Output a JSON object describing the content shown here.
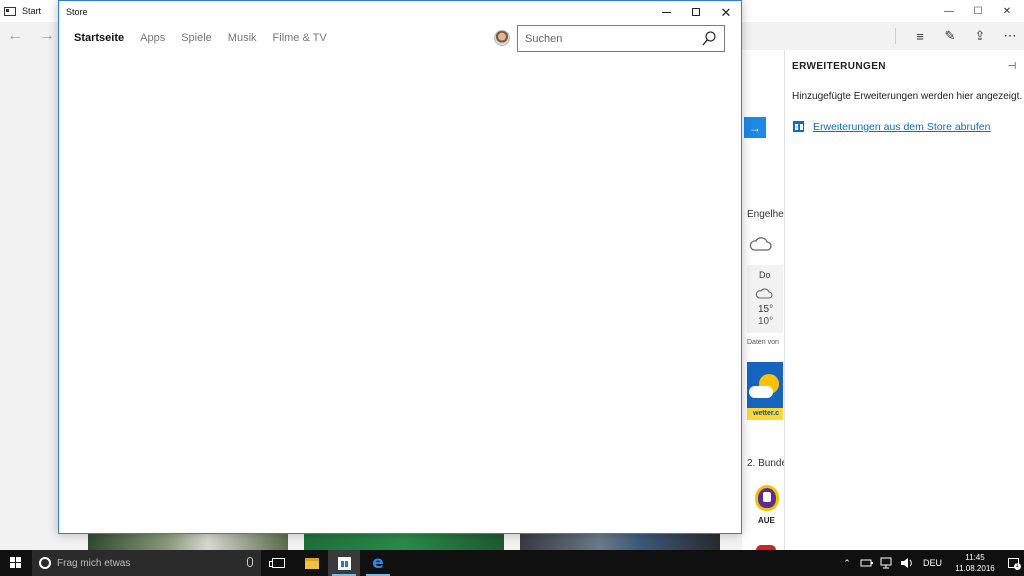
{
  "edge": {
    "tab_title": "Start",
    "window_controls": {
      "minimize": "—",
      "maximize": "☐",
      "close": "✕"
    },
    "nav": {
      "back": "←",
      "forward": "→"
    },
    "tools": {
      "hub": "≡",
      "note": "✎",
      "share": "⇪",
      "more": "⋯"
    },
    "page": {
      "go_arrow": "→",
      "weather_heading": "Engelhe",
      "weather_day": "Do",
      "weather_high": "15°",
      "weather_low": "10°",
      "weather_source": "Daten von",
      "ad_label": "wetter.c",
      "league_heading": "2. Bunde",
      "team_abbr": "AUE"
    },
    "hub": {
      "title": "ERWEITERUNGEN",
      "pin": "⊣",
      "info_text": "Hinzugefügte Erweiterungen werden hier angezeigt.",
      "store_link": "Erweiterungen aus dem Store abrufen"
    }
  },
  "store": {
    "title": "Store",
    "nav_items": [
      {
        "label": "Startseite",
        "active": true
      },
      {
        "label": "Apps",
        "active": false
      },
      {
        "label": "Spiele",
        "active": false
      },
      {
        "label": "Musik",
        "active": false
      },
      {
        "label": "Filme & TV",
        "active": false
      }
    ],
    "search": {
      "placeholder": "Suchen",
      "value": ""
    }
  },
  "taskbar": {
    "search_placeholder": "Frag mich etwas",
    "tray": {
      "expand": "⌃",
      "language": "DEU"
    },
    "clock": {
      "time": "11:45",
      "date": "11.08.2016"
    },
    "notification_count": "1"
  },
  "colors": {
    "accent": "#0a6ec8",
    "store_border": "#2d7fcf",
    "taskbar": "#101010",
    "edge_button": "#1e88e5"
  }
}
